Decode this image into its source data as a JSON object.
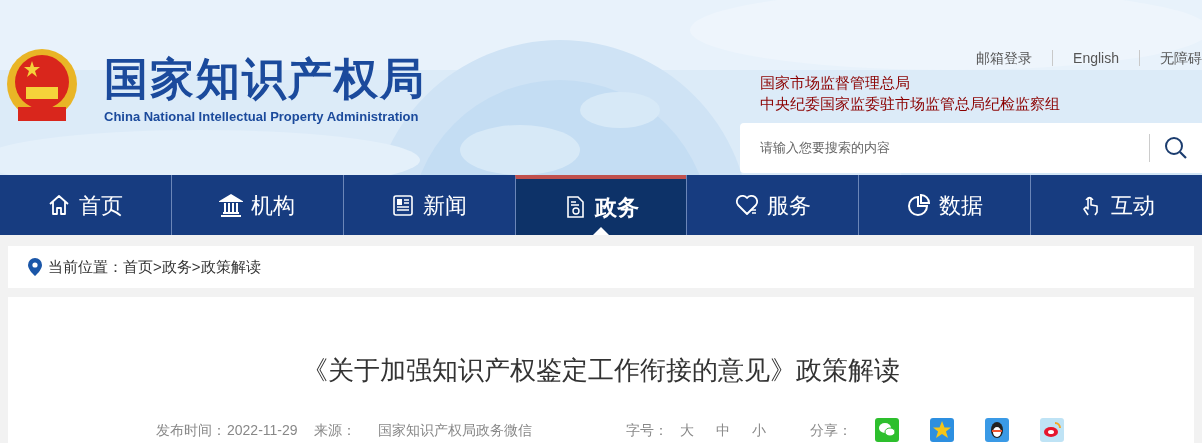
{
  "header": {
    "site_title": "国家知识产权局",
    "site_subtitle": "China National Intellectual Property Administration",
    "top_links": [
      "邮箱登录",
      "English",
      "无障碍"
    ],
    "affiliations": [
      "国家市场监督管理总局",
      "中央纪委国家监委驻市场监管总局纪检监察组"
    ],
    "search": {
      "placeholder": "请输入您要搜索的内容"
    }
  },
  "nav": [
    {
      "label": "首页",
      "kind": "home",
      "selected": false
    },
    {
      "label": "机构",
      "kind": "institution",
      "selected": false
    },
    {
      "label": "新闻",
      "kind": "news",
      "selected": false
    },
    {
      "label": "政务",
      "kind": "document",
      "selected": true
    },
    {
      "label": "服务",
      "kind": "heart",
      "selected": false
    },
    {
      "label": "数据",
      "kind": "pie",
      "selected": false
    },
    {
      "label": "互动",
      "kind": "hand",
      "selected": false
    }
  ],
  "breadcrumb": {
    "label": "当前位置：",
    "separator": ">",
    "path": [
      "首页",
      "政务",
      "政策解读"
    ]
  },
  "article": {
    "title": "《关于加强知识产权鉴定工作衔接的意见》政策解读",
    "meta": {
      "date_label": "发布时间：",
      "date": "2022-11-29",
      "source_label": "来源：",
      "source": "国家知识产权局政务微信",
      "font_size_label": "字号：",
      "font_sizes": [
        "大",
        "中",
        "小"
      ],
      "share_label": "分享：",
      "share": [
        {
          "kind": "wechat"
        },
        {
          "kind": "qzone"
        },
        {
          "kind": "qq"
        },
        {
          "kind": "weibo"
        }
      ]
    }
  }
}
